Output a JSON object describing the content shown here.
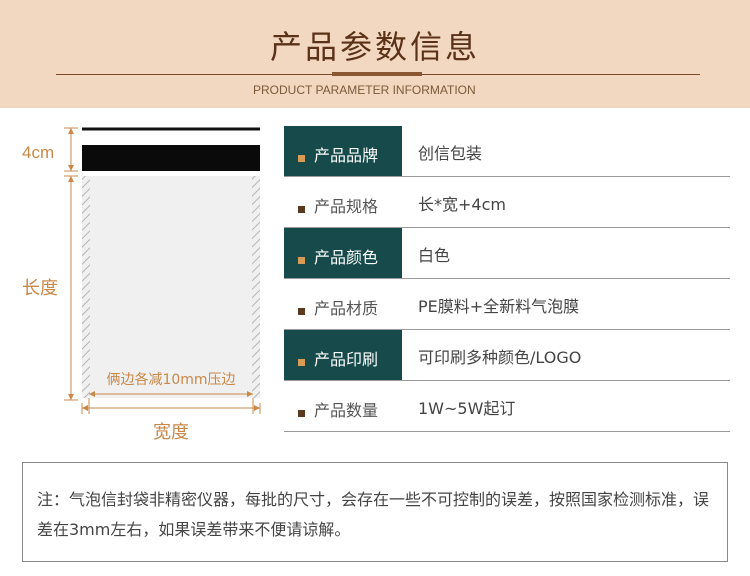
{
  "header": {
    "title": "产品参数信息",
    "subtitle": "PRODUCT PARAMETER INFORMATION"
  },
  "diagram": {
    "flap_label": "4cm",
    "length_label": "长度",
    "width_label": "宽度",
    "seal_label": "俩边各减10mm压边"
  },
  "params": [
    {
      "label": "产品品牌",
      "value": "创信包装"
    },
    {
      "label": "产品规格",
      "value": "长*宽+4cm"
    },
    {
      "label": "产品颜色",
      "value": "白色"
    },
    {
      "label": "产品材质",
      "value": "PE膜料+全新料气泡膜"
    },
    {
      "label": "产品印刷",
      "value": "可印刷多种颜色/LOGO"
    },
    {
      "label": "产品数量",
      "value": "1W~5W起订"
    }
  ],
  "note": {
    "text": "注：气泡信封袋非精密仪器，每批的尺寸，会存在一些不可控制的误差，按照国家检测标准，误差在3mm左右，如果误差带来不便请谅解。"
  },
  "colors": {
    "header_bg": "#f2d8c0",
    "accent_teal": "#174a4a",
    "dimension_brown": "#c88848"
  }
}
